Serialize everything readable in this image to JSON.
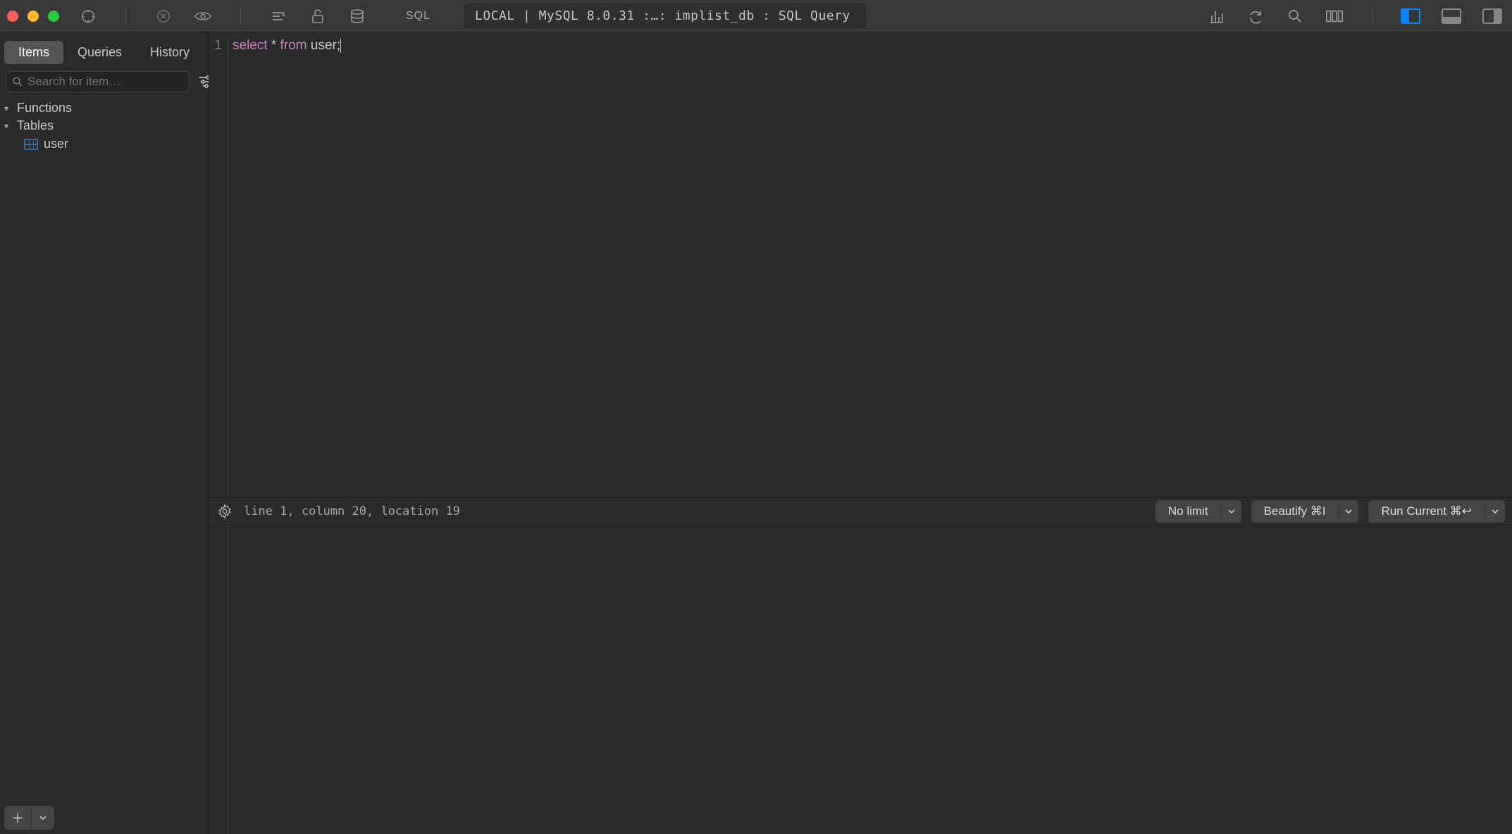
{
  "titlebar": {
    "path": "LOCAL | MySQL 8.0.31 :…: implist_db : SQL Query",
    "sql_label": "SQL"
  },
  "sidebar": {
    "tabs": {
      "items": "Items",
      "queries": "Queries",
      "history": "History",
      "active": "Items"
    },
    "search_placeholder": "Search for item…",
    "tree": {
      "functions": "Functions",
      "tables": "Tables",
      "table_items": [
        "user"
      ]
    }
  },
  "editor": {
    "lines": [
      {
        "n": "1",
        "tokens": [
          {
            "t": "kw",
            "v": "select"
          },
          {
            "t": "plain",
            "v": " * "
          },
          {
            "t": "kw",
            "v": "from"
          },
          {
            "t": "plain",
            "v": " user;"
          }
        ]
      }
    ]
  },
  "status": {
    "cursor": "line 1, column 20, location 19",
    "no_limit": "No limit",
    "beautify": "Beautify ⌘I",
    "run": "Run Current ⌘↩"
  }
}
